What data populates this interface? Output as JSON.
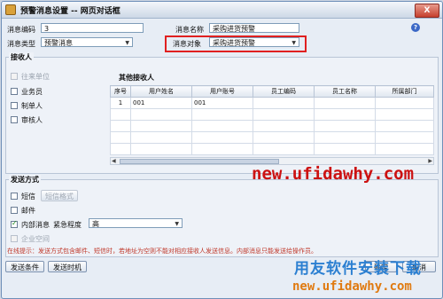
{
  "window": {
    "title": "预警消息设置 -- 网页对话框",
    "close_label": "X"
  },
  "form": {
    "msg_code_label": "消息编码",
    "msg_code_value": "3",
    "msg_name_label": "消息名称",
    "msg_name_value": "采购进货预警",
    "msg_type_label": "消息类型",
    "msg_type_value": "预警消息",
    "msg_target_label": "消息对象",
    "msg_target_value": "采购进货预警"
  },
  "receivers": {
    "title": "接收人",
    "options": [
      {
        "label": "往来单位",
        "checked": false,
        "disabled": true
      },
      {
        "label": "业务员",
        "checked": false,
        "disabled": false
      },
      {
        "label": "制单人",
        "checked": false,
        "disabled": false
      },
      {
        "label": "审核人",
        "checked": false,
        "disabled": false
      }
    ],
    "other_title": "其他接收人",
    "columns": [
      "序号",
      "用户姓名",
      "用户账号",
      "员工编码",
      "员工名称",
      "所属部门"
    ],
    "rows": [
      [
        "1",
        "001",
        "001",
        "",
        "",
        ""
      ]
    ]
  },
  "send": {
    "title": "发送方式",
    "sms_label": "短信",
    "sms_format_btn": "短信格式",
    "mail_label": "邮件",
    "internal_label": "内部消息",
    "urgency_label": "紧急程度",
    "urgency_value": "高",
    "enterprise_label": "企业空间",
    "hint": "在线提示：发送方式包含邮件、短信时，若地址为空则不能对相应接收人发送信息。内部消息只能发送给操作员。"
  },
  "buttons": {
    "send_conditions": "发送条件",
    "send_time": "发送时机",
    "ok": "确定",
    "cancel": "取消"
  },
  "watermarks": {
    "url_large": "new.ufidawhy.com",
    "brand": "用友软件安装下载",
    "url_small": "new.ufidawhy.com"
  }
}
